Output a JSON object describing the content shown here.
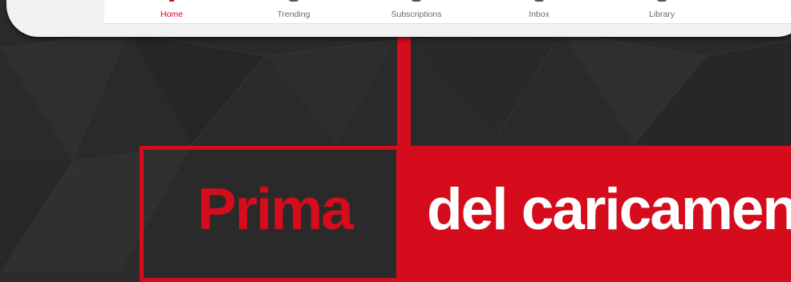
{
  "nav": {
    "items": [
      {
        "label": "Home",
        "icon": "home-icon",
        "active": true
      },
      {
        "label": "Trending",
        "icon": "trending-icon",
        "active": false
      },
      {
        "label": "Subscriptions",
        "icon": "subscriptions-icon",
        "active": false
      },
      {
        "label": "Inbox",
        "icon": "inbox-icon",
        "active": false
      },
      {
        "label": "Library",
        "icon": "library-icon",
        "active": false
      }
    ]
  },
  "banner": {
    "left_word": "Prima",
    "right_text": "del caricamento"
  },
  "colors": {
    "accent": "#d50c1c",
    "background": "#2b2b2b",
    "active_nav": "#e00020"
  }
}
